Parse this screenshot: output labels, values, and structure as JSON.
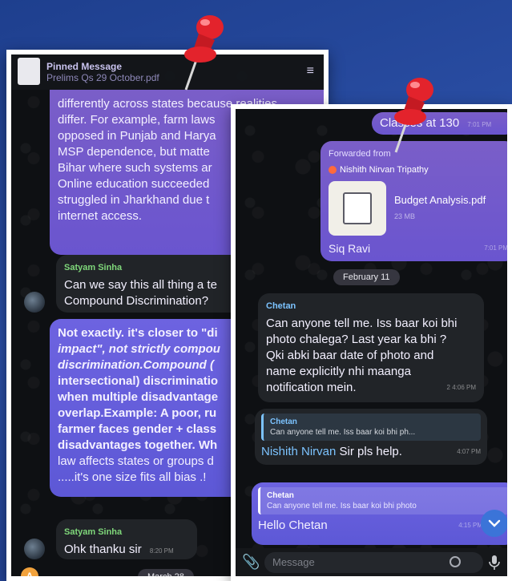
{
  "left_chat": {
    "pinned": {
      "title": "Pinned Message",
      "file": "Prelims Qs 29 October.pdf"
    },
    "message1_lines": [
      "differently across states because realities",
      "differ. For example, farm laws",
      "opposed in Punjab and Harya",
      "MSP dependence, but matte",
      "Bihar where such systems ar",
      "Online education succeeded",
      "struggled in Jharkhand due t",
      "internet access."
    ],
    "message2": {
      "sender": "Satyam Sinha",
      "lines": [
        "Can we say this all thing a te",
        "Compound Discrimination?"
      ]
    },
    "message3_lines": [
      "Not exactly. it's closer to \"di",
      "impact\", not strictly compou",
      "discrimination.Compound (",
      "intersectional) discriminatio",
      "when multiple disadvantage",
      "overlap.Example: A poor, ru",
      "farmer faces gender + class",
      "disadvantages together. Wh",
      "law affects states or groups d",
      ".....it's one size fits all bias .!"
    ],
    "message4": {
      "sender": "Satyam Sinha",
      "text": "Ohk thanku sir",
      "time": "8:20 PM"
    },
    "date_chip": "March 28",
    "avatar_letter": "A"
  },
  "right_chat": {
    "top_text": "Classes at 130",
    "top_time": "7:01 PM",
    "forward": {
      "label": "Forwarded from",
      "from": "Nishith Nirvan Tripathy",
      "file_name": "Budget Analysis.pdf",
      "file_size": "23 MB",
      "caption": "Siq Ravi",
      "time": "7:01 PM"
    },
    "date_chip": "February 11",
    "message1": {
      "sender": "Chetan",
      "lines": [
        "Can anyone tell me. Iss baar koi bhi",
        "photo chalega? Last year ka bhi ?",
        "Qki abki baar date of photo and",
        "name explicitly nhi maanga",
        "notification mein."
      ],
      "meta": "2 4:06 PM"
    },
    "reply1": {
      "quoted_sender": "Chetan",
      "quoted_text": "Can anyone tell me. Iss baar koi bhi ph...",
      "mention": "Nishith Nirvan",
      "text": " Sir pls help.",
      "time": "4:07 PM"
    },
    "reply2": {
      "quoted_sender": "Chetan",
      "quoted_text": "Can anyone tell me. Iss baar koi bhi photo",
      "text": "Hello Chetan",
      "time": "4:15 PM"
    },
    "composer": {
      "placeholder": "Message"
    }
  }
}
